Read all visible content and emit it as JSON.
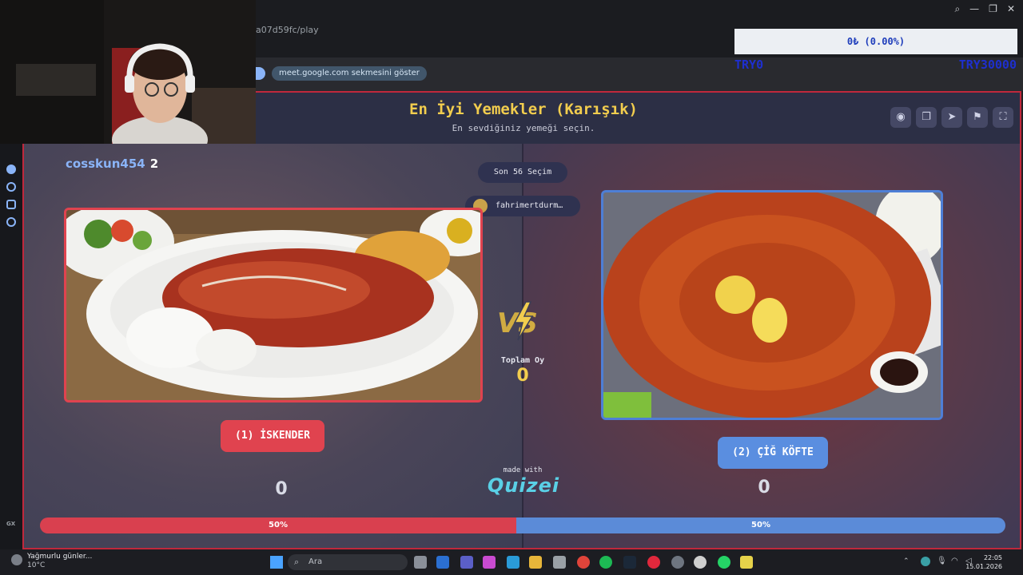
{
  "browser": {
    "url_fragment": "a07d59fc/play",
    "tab_pill": "meet.google.com sekmesini göster"
  },
  "stream_overlay": {
    "donation_title": "",
    "donation_text": "0₺ (0.00%)",
    "goal_min": "TRY0",
    "goal_max": "TRY30000"
  },
  "quiz": {
    "title": "En İyi Yemekler (Karışık)",
    "subtitle": "En sevdiğiniz yemeği seçin.",
    "player_name": "cosskun454",
    "player_count": "2",
    "last_choices": "Son 56 Seçim",
    "recent_user": "fahrimertdurm…",
    "total_label": "Toplam Oy",
    "total_value": "0",
    "made_with": "made with",
    "brand": "Quizei",
    "left": {
      "label": "(1) İSKENDER",
      "score": "0",
      "percent": "50%",
      "color": "#e0434f"
    },
    "right": {
      "label": "(2) ÇİĞ KÖFTE",
      "score": "0",
      "percent": "50%",
      "color": "#5a8ee0"
    }
  },
  "taskbar": {
    "weather_text": "Yağmurlu günler...",
    "weather_temp": "10°C",
    "search_placeholder": "Ara",
    "time": "22:05",
    "date": "15.01.2026"
  },
  "sidebar": {
    "gx_label": "GX"
  }
}
